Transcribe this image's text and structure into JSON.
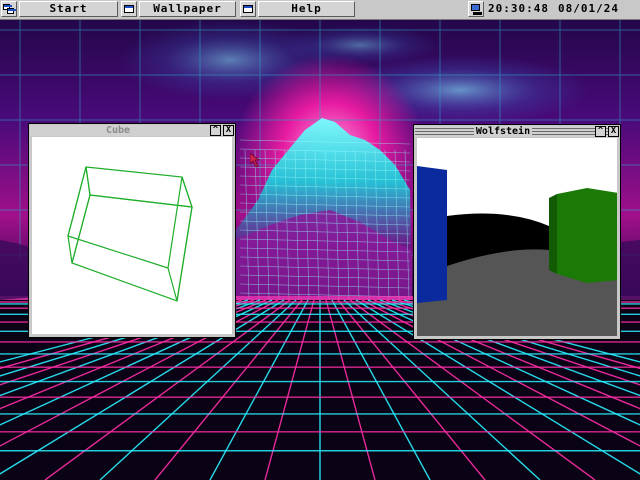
{
  "taskbar": {
    "start_label": "Start",
    "apps": [
      {
        "label": "Wallpaper"
      },
      {
        "label": "Help"
      }
    ],
    "time": "20:30:48",
    "date": "08/01/24"
  },
  "windows": {
    "cube": {
      "title": "Cube",
      "minimize_glyph": "^",
      "close_glyph": "X",
      "state": "inactive"
    },
    "wolfstein": {
      "title": "Wolfstein",
      "minimize_glyph": "^",
      "close_glyph": "X",
      "state": "active"
    }
  },
  "icons": {
    "start": "start-menu-icon",
    "app_window": "window-icon",
    "clock": "computer-icon",
    "pointer": "mouse-pointer-icon"
  },
  "colors": {
    "cube_wire": "#1fae2a",
    "wolf_blue_wall": "#0a2a9e",
    "wolf_green_wall": "#1a7a05",
    "wolf_ceiling": "#ffffff",
    "wolf_floor": "#555555",
    "neon_pink": "#ff2ea6",
    "neon_cyan": "#28f0ff"
  }
}
